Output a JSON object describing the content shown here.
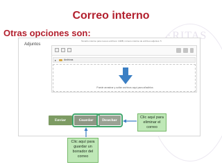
{
  "header": {
    "title": "Correo interno",
    "subtitle": "Otras opciones son:"
  },
  "watermark": {
    "text": "VERITAS"
  },
  "attachments": {
    "label": "Adjuntos",
    "limit_text": "Tamaño máximo para nuevos archivos: 10MB, número máximo de archivos adjuntos: 5",
    "folder_label": "Archivos",
    "drop_text": "Puede arrastrar y soltar archivos aquí para añadirlos"
  },
  "buttons": {
    "send": "Enviar",
    "save": "Guardar",
    "discard": "Desechar"
  },
  "callouts": {
    "delete": "Clic aquí para eliminar el correo",
    "save": "Clic aquí para guardar un borrador del correo"
  },
  "colors": {
    "accent": "#b21f2d",
    "highlight": "#3fa56a",
    "callout_bg": "#bfe8b7",
    "send": "#7d9b63",
    "arrow": "#3b7fc4"
  }
}
